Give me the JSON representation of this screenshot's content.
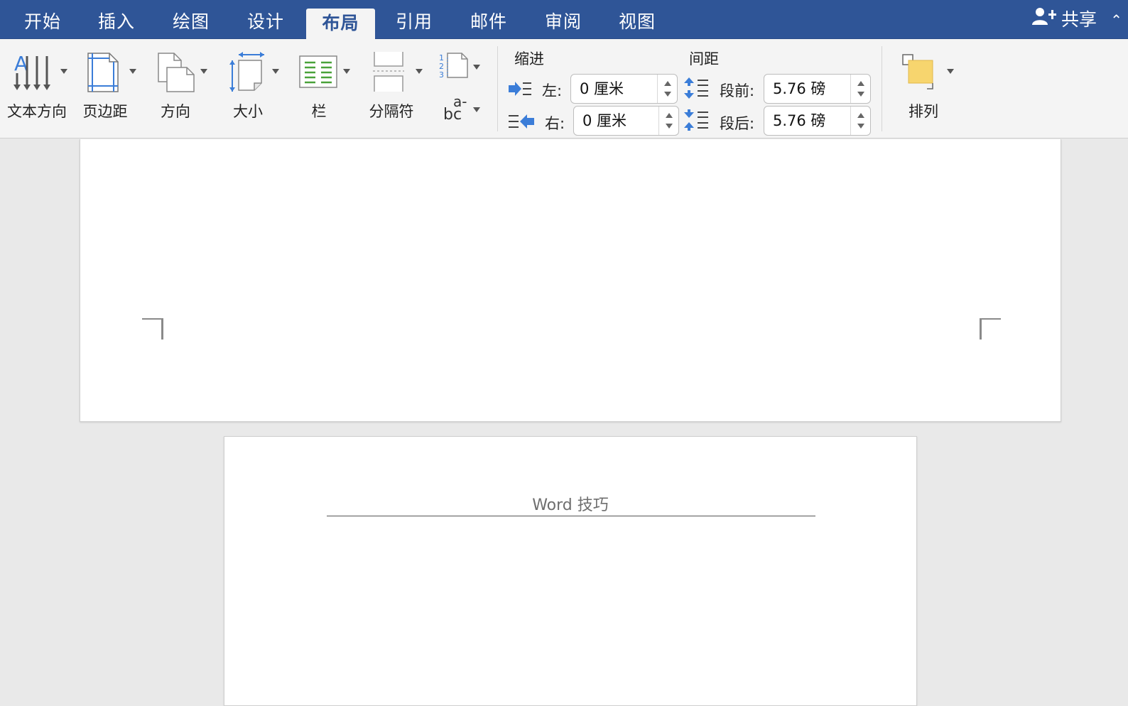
{
  "tabs": [
    {
      "label": "开始"
    },
    {
      "label": "插入"
    },
    {
      "label": "绘图"
    },
    {
      "label": "设计"
    },
    {
      "label": "布局",
      "active": true
    },
    {
      "label": "引用"
    },
    {
      "label": "邮件"
    },
    {
      "label": "审阅"
    },
    {
      "label": "视图"
    }
  ],
  "share": {
    "label": "共享",
    "icon": "add-person-icon"
  },
  "ribbon": {
    "text_direction": "文本方向",
    "margins": "页边距",
    "orientation": "方向",
    "size": "大小",
    "columns": "栏",
    "breaks": "分隔符",
    "hyphenation_glyph_top": "a-",
    "hyphenation_glyph_bottom": "bc",
    "arrange": "排列",
    "indent": {
      "title": "缩进",
      "left_label": "左:",
      "left_value": "0 厘米",
      "right_label": "右:",
      "right_value": "0 厘米"
    },
    "spacing": {
      "title": "间距",
      "before_label": "段前:",
      "before_value": "5.76 磅",
      "after_label": "段后:",
      "after_value": "5.76 磅"
    }
  },
  "document": {
    "header_text": "Word 技巧"
  },
  "colors": {
    "tabbar": "#2f5597",
    "ribbon": "#f4f4f4",
    "canvas": "#e9e9e9",
    "accent_blue": "#3b7dd8",
    "accent_green": "#4aa23a",
    "arrange_yellow": "#f7d56e"
  }
}
